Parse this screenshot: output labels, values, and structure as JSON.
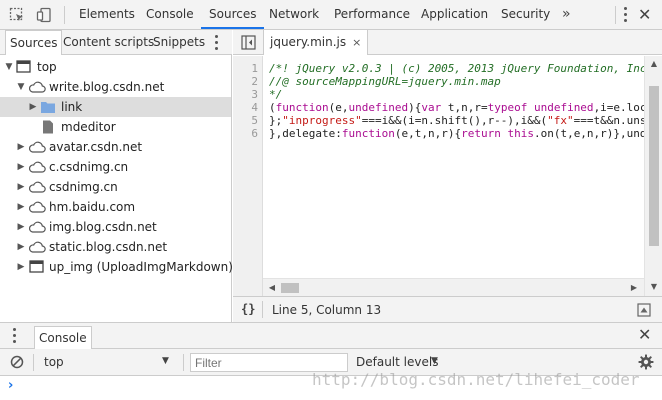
{
  "toolbar": {
    "tabs": [
      "Elements",
      "Console",
      "Sources",
      "Network",
      "Performance",
      "Application",
      "Security"
    ],
    "active_tab": "Sources",
    "more_label": "»"
  },
  "navigator": {
    "tabs": [
      "Sources",
      "Content scripts",
      "Snippets"
    ],
    "active_tab": "Sources",
    "tree": [
      {
        "label": "top",
        "expanded": true,
        "icon": "frame-icon"
      },
      {
        "label": "write.blog.csdn.net",
        "expanded": true,
        "icon": "cloud-icon"
      },
      {
        "label": "link",
        "expanded": false,
        "icon": "folder-icon",
        "selected": true
      },
      {
        "label": "mdeditor",
        "icon": "file-icon"
      },
      {
        "label": "avatar.csdn.net",
        "expanded": false,
        "icon": "cloud-icon"
      },
      {
        "label": "c.csdnimg.cn",
        "expanded": false,
        "icon": "cloud-icon"
      },
      {
        "label": "csdnimg.cn",
        "expanded": false,
        "icon": "cloud-icon"
      },
      {
        "label": "hm.baidu.com",
        "expanded": false,
        "icon": "cloud-icon"
      },
      {
        "label": "img.blog.csdn.net",
        "expanded": false,
        "icon": "cloud-icon"
      },
      {
        "label": "static.blog.csdn.net",
        "expanded": false,
        "icon": "cloud-icon"
      },
      {
        "label": "up_img (UploadImgMarkdown)",
        "expanded": false,
        "icon": "frame-icon"
      }
    ]
  },
  "editor": {
    "file_tab": "jquery.min.js",
    "close_glyph": "×",
    "line_numbers": [
      "1",
      "2",
      "3",
      "4",
      "5",
      "6"
    ],
    "lines": [
      [
        {
          "t": "/*! jQuery v2.0.3 | (c) 2005, 2013 jQuery Foundation, Inc",
          "c": "#236e25",
          "i": true
        }
      ],
      [
        {
          "t": "//@ sourceMappingURL=jquery.min.map",
          "c": "#236e25",
          "i": true
        }
      ],
      [
        {
          "t": "*/",
          "c": "#236e25",
          "i": true
        }
      ],
      [
        {
          "t": "(",
          "c": "#222"
        },
        {
          "t": "function",
          "c": "#aa0d91"
        },
        {
          "t": "(e,",
          "c": "#222"
        },
        {
          "t": "undefined",
          "c": "#aa0d91"
        },
        {
          "t": "){",
          "c": "#222"
        },
        {
          "t": "var",
          "c": "#aa0d91"
        },
        {
          "t": " t,n,r=",
          "c": "#222"
        },
        {
          "t": "typeof",
          "c": "#aa0d91"
        },
        {
          "t": " ",
          "c": "#222"
        },
        {
          "t": "undefined",
          "c": "#aa0d91"
        },
        {
          "t": ",i=e.loc",
          "c": "#222"
        }
      ],
      [
        {
          "t": "};",
          "c": "#222"
        },
        {
          "t": "\"inprogress\"",
          "c": "#c41a16"
        },
        {
          "t": "===i&&(i=n.shift(),r--),i&&(",
          "c": "#222"
        },
        {
          "t": "\"fx\"",
          "c": "#c41a16"
        },
        {
          "t": "===t&&n.uns",
          "c": "#222"
        }
      ],
      [
        {
          "t": "},delegate:",
          "c": "#222"
        },
        {
          "t": "function",
          "c": "#aa0d91"
        },
        {
          "t": "(e,t,n,r){",
          "c": "#222"
        },
        {
          "t": "return",
          "c": "#aa0d91"
        },
        {
          "t": " ",
          "c": "#222"
        },
        {
          "t": "this",
          "c": "#aa0d91"
        },
        {
          "t": ".on(t,e,n,r)},und",
          "c": "#222"
        }
      ]
    ],
    "status": {
      "pretty_print": "{}",
      "position": "Line 5, Column 13"
    },
    "vertical_scroll_fraction": 0.31
  },
  "drawer": {
    "tab": "Console",
    "context_select": "top",
    "filter_placeholder": "Filter",
    "levels": "Default levels",
    "prompt": "›"
  },
  "watermark": "http://blog.csdn.net/lihefei_coder",
  "colors": {
    "accent": "#1a73e8",
    "folder": "#7aa7e0",
    "icon_gray": "#666666"
  }
}
